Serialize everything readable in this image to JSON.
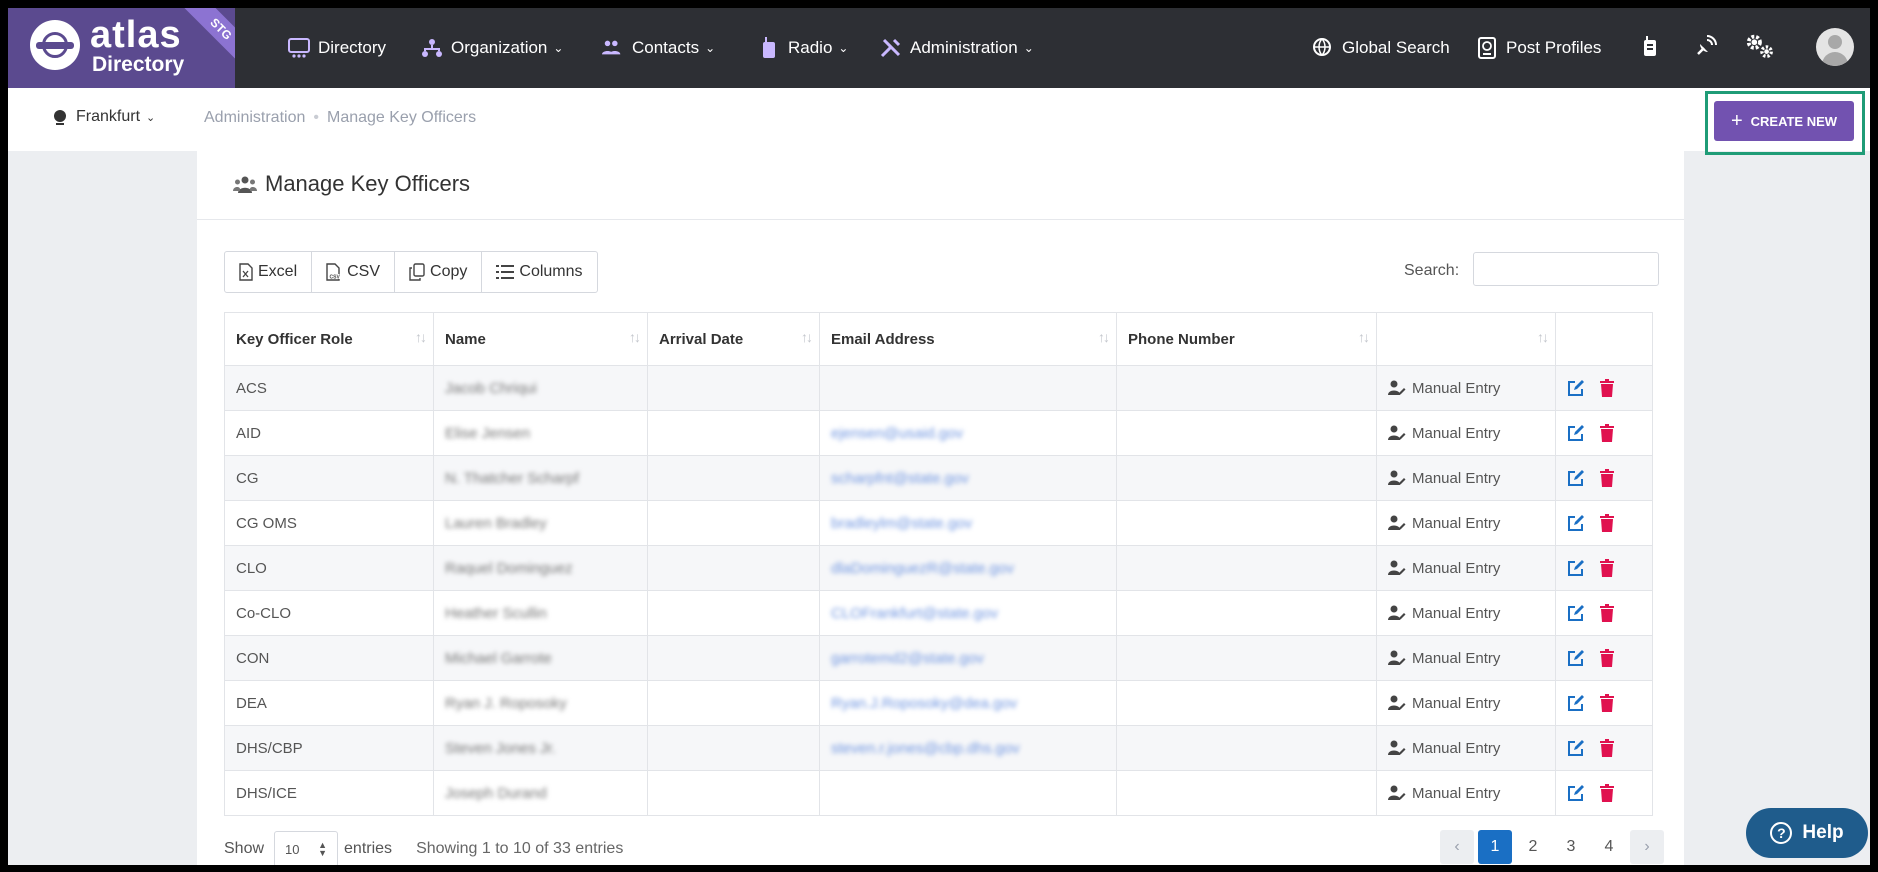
{
  "brand": {
    "word": "atlas",
    "sub": "Directory",
    "env": "STG"
  },
  "nav": {
    "items": [
      {
        "label": "Directory",
        "dropdown": false
      },
      {
        "label": "Organization",
        "dropdown": true
      },
      {
        "label": "Contacts",
        "dropdown": true
      },
      {
        "label": "Radio",
        "dropdown": true
      },
      {
        "label": "Administration",
        "dropdown": true
      }
    ],
    "global_search": "Global Search",
    "post_profiles": "Post Profiles"
  },
  "subbar": {
    "site": "Frankfurt",
    "breadcrumb": [
      "Administration",
      "Manage Key Officers"
    ],
    "create_label": "CREATE NEW"
  },
  "page": {
    "title": "Manage Key Officers"
  },
  "toolbar": {
    "excel": "Excel",
    "csv": "CSV",
    "copy": "Copy",
    "columns": "Columns",
    "search_label": "Search:",
    "search_value": ""
  },
  "table": {
    "columns": [
      "Key Officer Role",
      "Name",
      "Arrival Date",
      "Email Address",
      "Phone Number",
      ""
    ],
    "rows": [
      {
        "role": "ACS",
        "name": "Jacob Chriqui",
        "arrival": "",
        "email": "",
        "phone": "",
        "source": "Manual Entry"
      },
      {
        "role": "AID",
        "name": "Elise Jensen",
        "arrival": "",
        "email": "ejensen@usaid.gov",
        "phone": "",
        "source": "Manual Entry"
      },
      {
        "role": "CG",
        "name": "N. Thatcher Scharpf",
        "arrival": "",
        "email": "scharpfnt@state.gov",
        "phone": "",
        "source": "Manual Entry"
      },
      {
        "role": "CG OMS",
        "name": "Lauren Bradley",
        "arrival": "",
        "email": "bradleylm@state.gov",
        "phone": "",
        "source": "Manual Entry"
      },
      {
        "role": "CLO",
        "name": "Raquel Dominguez",
        "arrival": "",
        "email": "dlaDominguezR@state.gov",
        "phone": "",
        "source": "Manual Entry"
      },
      {
        "role": "Co-CLO",
        "name": "Heather Scullin",
        "arrival": "",
        "email": "CLOFrankfurt@state.gov",
        "phone": "",
        "source": "Manual Entry"
      },
      {
        "role": "CON",
        "name": "Michael Garrote",
        "arrival": "",
        "email": "garrotemd2@state.gov",
        "phone": "",
        "source": "Manual Entry"
      },
      {
        "role": "DEA",
        "name": "Ryan J. Roposoky",
        "arrival": "",
        "email": "Ryan.J.Roposoky@dea.gov",
        "phone": "",
        "source": "Manual Entry"
      },
      {
        "role": "DHS/CBP",
        "name": "Steven Jones Jr.",
        "arrival": "",
        "email": "steven.r.jones@cbp.dhs.gov",
        "phone": "",
        "source": "Manual Entry"
      },
      {
        "role": "DHS/ICE",
        "name": "Joseph Durand",
        "arrival": "",
        "email": "",
        "phone": "",
        "source": "Manual Entry"
      }
    ]
  },
  "footer": {
    "show_label": "Show",
    "page_length": "10",
    "entries_label": "entries",
    "info": "Showing 1 to 10 of 33 entries",
    "pages": [
      "1",
      "2",
      "3",
      "4"
    ],
    "current_page": "1"
  },
  "help": {
    "label": "Help"
  },
  "colors": {
    "nav_bg": "#2d2f34",
    "brand": "#5b4a8f",
    "create": "#7252b0",
    "edit": "#1a6fc4",
    "delete": "#e0114f",
    "pager_active": "#1a6fc4",
    "help": "#1f5c8c",
    "highlight": "#1f9c77"
  }
}
